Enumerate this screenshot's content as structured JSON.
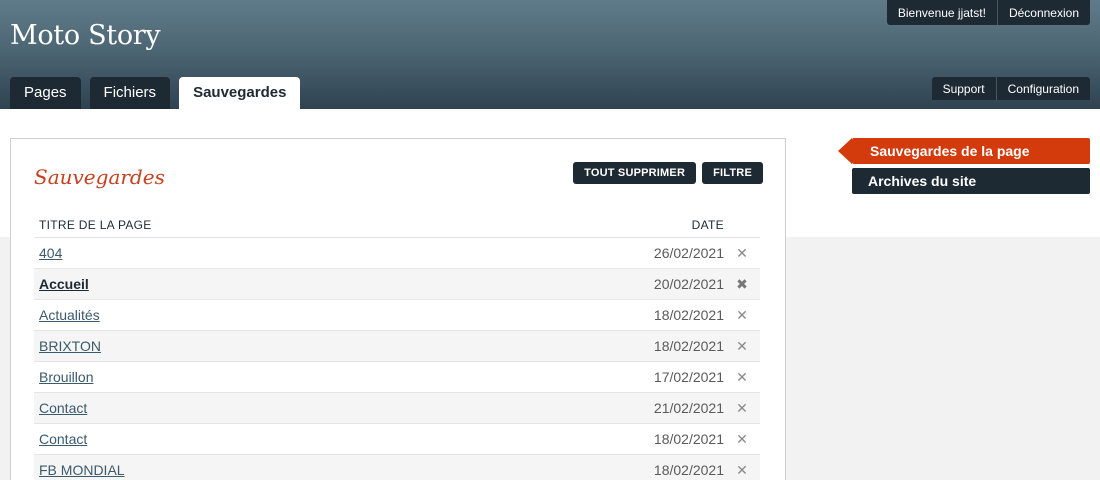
{
  "header": {
    "app_title": "Moto Story",
    "welcome": "Bienvenue jjatst!",
    "logout": "Déconnexion",
    "support": "Support",
    "configuration": "Configuration",
    "tabs": [
      {
        "label": "Pages",
        "active": false
      },
      {
        "label": "Fichiers",
        "active": false
      },
      {
        "label": "Sauvegardes",
        "active": true
      }
    ]
  },
  "panel": {
    "title": "Sauvegardes",
    "delete_all": "TOUT SUPPRIMER",
    "filter": "FILTRE",
    "columns": {
      "title": "TITRE DE LA PAGE",
      "date": "DATE"
    },
    "rows": [
      {
        "title": "404",
        "date": "26/02/2021",
        "delete": "✕"
      },
      {
        "title": "Accueil",
        "date": "20/02/2021",
        "delete": "✖"
      },
      {
        "title": "Actualités",
        "date": "18/02/2021",
        "delete": "✕"
      },
      {
        "title": "BRIXTON",
        "date": "18/02/2021",
        "delete": "✕"
      },
      {
        "title": "Brouillon",
        "date": "17/02/2021",
        "delete": "✕"
      },
      {
        "title": "Contact",
        "date": "21/02/2021",
        "delete": "✕"
      },
      {
        "title": "Contact",
        "date": "18/02/2021",
        "delete": "✕"
      },
      {
        "title": "FB MONDIAL",
        "date": "18/02/2021",
        "delete": "✕"
      }
    ]
  },
  "side_menu": {
    "items": [
      {
        "label": "Sauvegardes de la page",
        "active": true
      },
      {
        "label": "Archives du site",
        "active": false
      }
    ]
  },
  "colors": {
    "accent": "#d33b0c",
    "title_red": "#c7401f",
    "dark": "#1e2a33"
  }
}
